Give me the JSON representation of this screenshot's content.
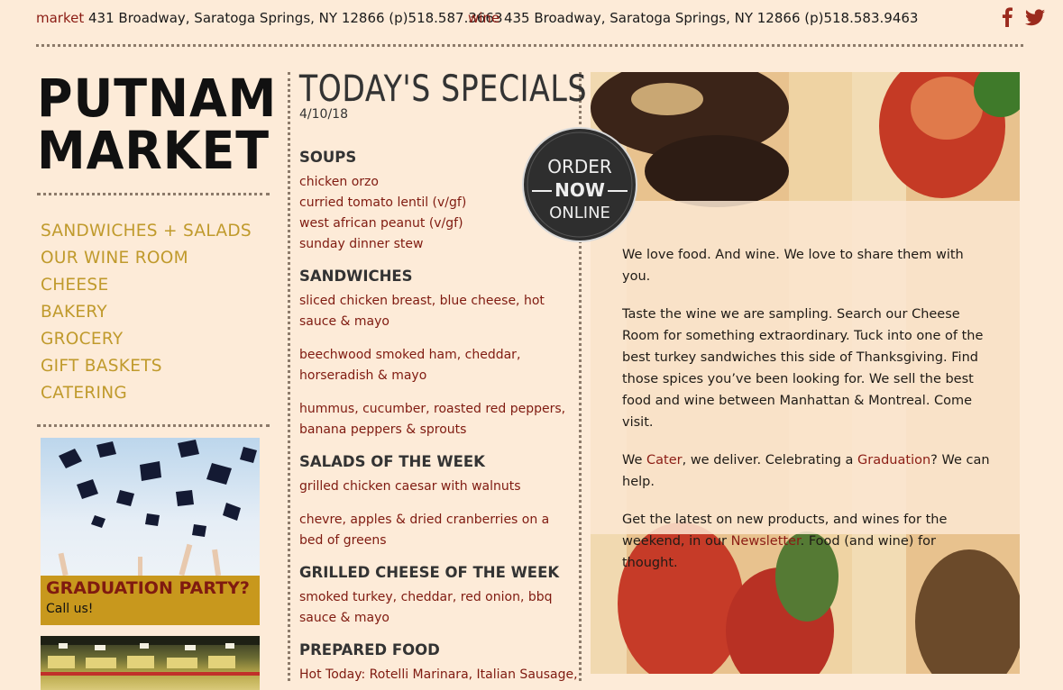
{
  "topbar": {
    "market_label": "market",
    "market_address": "431 Broadway, Saratoga Springs, NY 12866 (p)518.587.3663",
    "wine_label": "wine",
    "wine_address": "435 Broadway, Saratoga Springs, NY 12866 (p)518.583.9463",
    "social": [
      "facebook-icon",
      "twitter-icon"
    ]
  },
  "logo": {
    "line1": "PUTNAM",
    "line2": "MARKET"
  },
  "nav": {
    "items": [
      {
        "label": "SANDWICHES + SALADS"
      },
      {
        "label": "OUR WINE ROOM"
      },
      {
        "label": "CHEESE"
      },
      {
        "label": "BAKERY"
      },
      {
        "label": "GROCERY"
      },
      {
        "label": "GIFT BASKETS"
      },
      {
        "label": "CATERING"
      }
    ]
  },
  "promo": {
    "title": "GRADUATION PARTY?",
    "subtitle": "Call us!"
  },
  "specials": {
    "title": "TODAY'S SPECIALS",
    "date": "4/10/18",
    "sections": [
      {
        "heading": "SOUPS",
        "items": [
          "chicken orzo",
          "curried tomato lentil (v/gf)",
          "west african peanut (v/gf)",
          "sunday dinner stew"
        ]
      },
      {
        "heading": "SANDWICHES",
        "items": [
          "sliced chicken breast, blue cheese, hot sauce & mayo",
          "beechwood smoked ham, cheddar, horseradish & mayo",
          "hummus, cucumber, roasted red peppers, banana peppers & sprouts"
        ]
      },
      {
        "heading": "SALADS OF THE WEEK",
        "items": [
          "grilled chicken caesar with walnuts",
          "chevre, apples & dried cranberries on a bed of greens"
        ]
      },
      {
        "heading": "GRILLED CHEESE OF THE WEEK",
        "items": [
          "smoked turkey, cheddar, red onion, bbq sauce & mayo"
        ]
      },
      {
        "heading": "PREPARED FOOD",
        "items": [
          "Hot Today: Rotelli Marinara, Italian Sausage,"
        ]
      }
    ]
  },
  "order_badge": {
    "line1": "ORDER",
    "line2": "NOW",
    "line3": "ONLINE"
  },
  "copy": {
    "p1": "We love food.  And wine.  We love to share them with you.",
    "p2": "Taste the wine we are sampling.  Search our Cheese Room for something extraordinary.  Tuck into one of the best turkey sandwiches this side of Thanksgiving.  Find those spices you’ve been looking for.  We sell the best food and wine between Manhattan & Montreal.  Come visit.",
    "p3_a": "We ",
    "p3_link1": "Cater",
    "p3_b": ", we deliver.  Celebrating a ",
    "p3_link2": "Graduation",
    "p3_c": "?  We can help.",
    "p4_a": "Get the latest on new products, and wines for the weekend, in our ",
    "p4_link": "Newsletter",
    "p4_b": ".  Food (and wine) for thought."
  },
  "colors": {
    "background": "#fdebd8",
    "brand_red": "#8b1c14",
    "nav_gold": "#c09a2c",
    "promo_gold": "#c8981d"
  }
}
